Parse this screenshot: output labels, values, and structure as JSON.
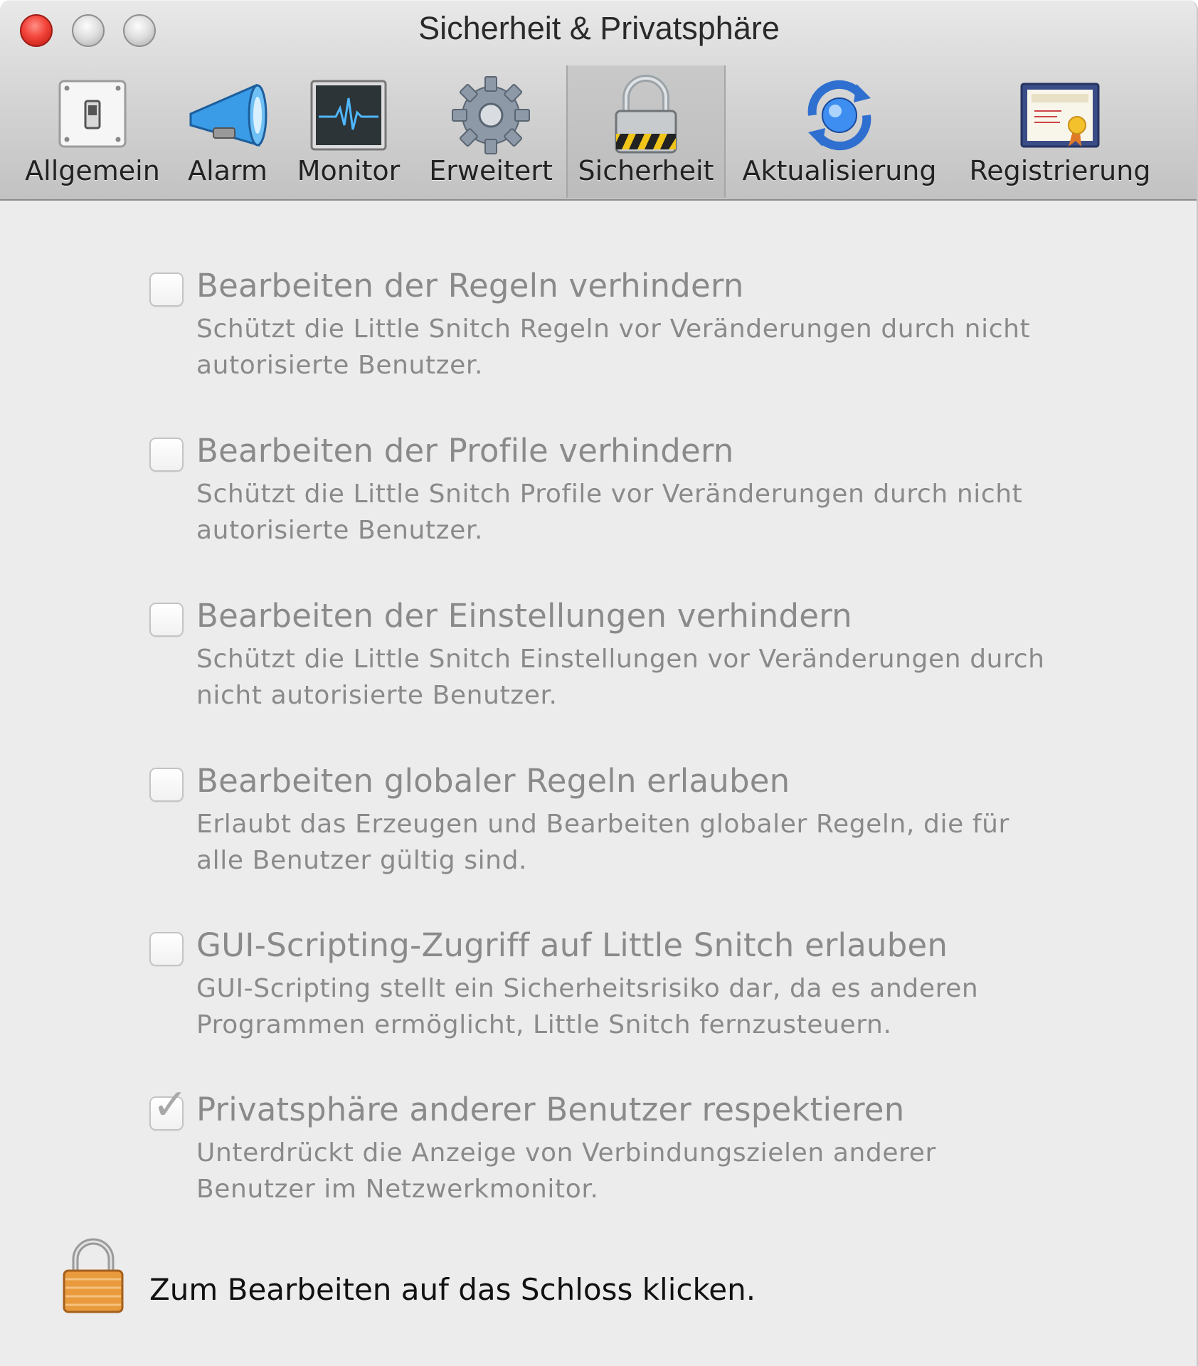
{
  "window": {
    "title": "Sicherheit & Privatsphäre"
  },
  "toolbar": {
    "items": [
      {
        "label": "Allgemein",
        "icon": "switch-icon"
      },
      {
        "label": "Alarm",
        "icon": "megaphone-icon"
      },
      {
        "label": "Monitor",
        "icon": "monitor-icon"
      },
      {
        "label": "Erweitert",
        "icon": "gear-icon"
      },
      {
        "label": "Sicherheit",
        "icon": "padlock-icon",
        "selected": true
      },
      {
        "label": "Aktualisierung",
        "icon": "update-globe-icon"
      },
      {
        "label": "Registrierung",
        "icon": "license-certificate-icon"
      }
    ]
  },
  "options": [
    {
      "title": "Bearbeiten der Regeln verhindern",
      "description": "Schützt die Little Snitch Regeln vor Veränderungen durch nicht autorisierte Benutzer.",
      "checked": false
    },
    {
      "title": "Bearbeiten der Profile verhindern",
      "description": "Schützt die Little Snitch Profile vor Veränderungen durch nicht autorisierte Benutzer.",
      "checked": false
    },
    {
      "title": "Bearbeiten der Einstellungen verhindern",
      "description": "Schützt die Little Snitch Einstellungen vor Veränderungen durch nicht autorisierte Benutzer.",
      "checked": false
    },
    {
      "title": "Bearbeiten globaler Regeln erlauben",
      "description": "Erlaubt das Erzeugen und Bearbeiten globaler Regeln, die für alle Benutzer gültig sind.",
      "checked": false
    },
    {
      "title": "GUI-Scripting-Zugriff auf Little Snitch erlauben",
      "description": "GUI-Scripting stellt ein Sicherheitsrisiko dar, da es anderen Programmen ermöglicht, Little Snitch fernzusteuern.",
      "checked": false
    },
    {
      "title": "Privatsphäre anderer Benutzer respektieren",
      "description": "Unterdrückt die Anzeige von Verbindungszielen anderer Benutzer im Netzwerkmonitor.",
      "checked": true
    }
  ],
  "lock": {
    "text": "Zum Bearbeiten auf das Schloss klicken.",
    "icon": "padlock-icon",
    "check_symbol": "✓"
  },
  "colors": {
    "close_button": "#f2443a",
    "disabled_text": "#8a8a8a",
    "lock_body": "#e89a3c"
  }
}
